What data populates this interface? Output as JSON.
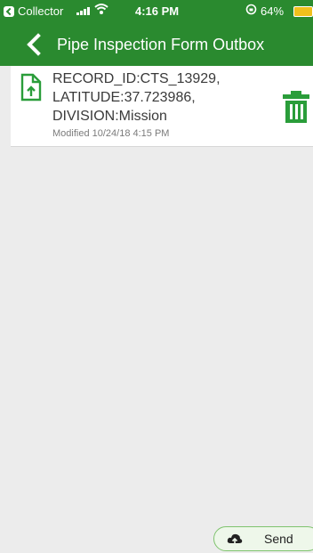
{
  "status_bar": {
    "back_app_label": "Collector",
    "time": "4:16 PM",
    "battery_percent": "64%"
  },
  "nav": {
    "title": "Pipe Inspection Form Outbox"
  },
  "outbox": {
    "items": [
      {
        "lines": [
          "RECORD_ID:CTS_13929,",
          "LATITUDE:37.723986,",
          "DIVISION:Mission"
        ],
        "modified": "Modified 10/24/18 4:15 PM"
      }
    ]
  },
  "actions": {
    "send_label": "Send"
  },
  "colors": {
    "accent": "#2a8a2f",
    "send_bg": "#eef7ea"
  },
  "icons": [
    "back-app-icon",
    "signal-icon",
    "wifi-icon",
    "rotation-lock-icon",
    "battery-icon",
    "chevron-left-icon",
    "document-upload-icon",
    "trash-icon",
    "cloud-upload-icon"
  ]
}
